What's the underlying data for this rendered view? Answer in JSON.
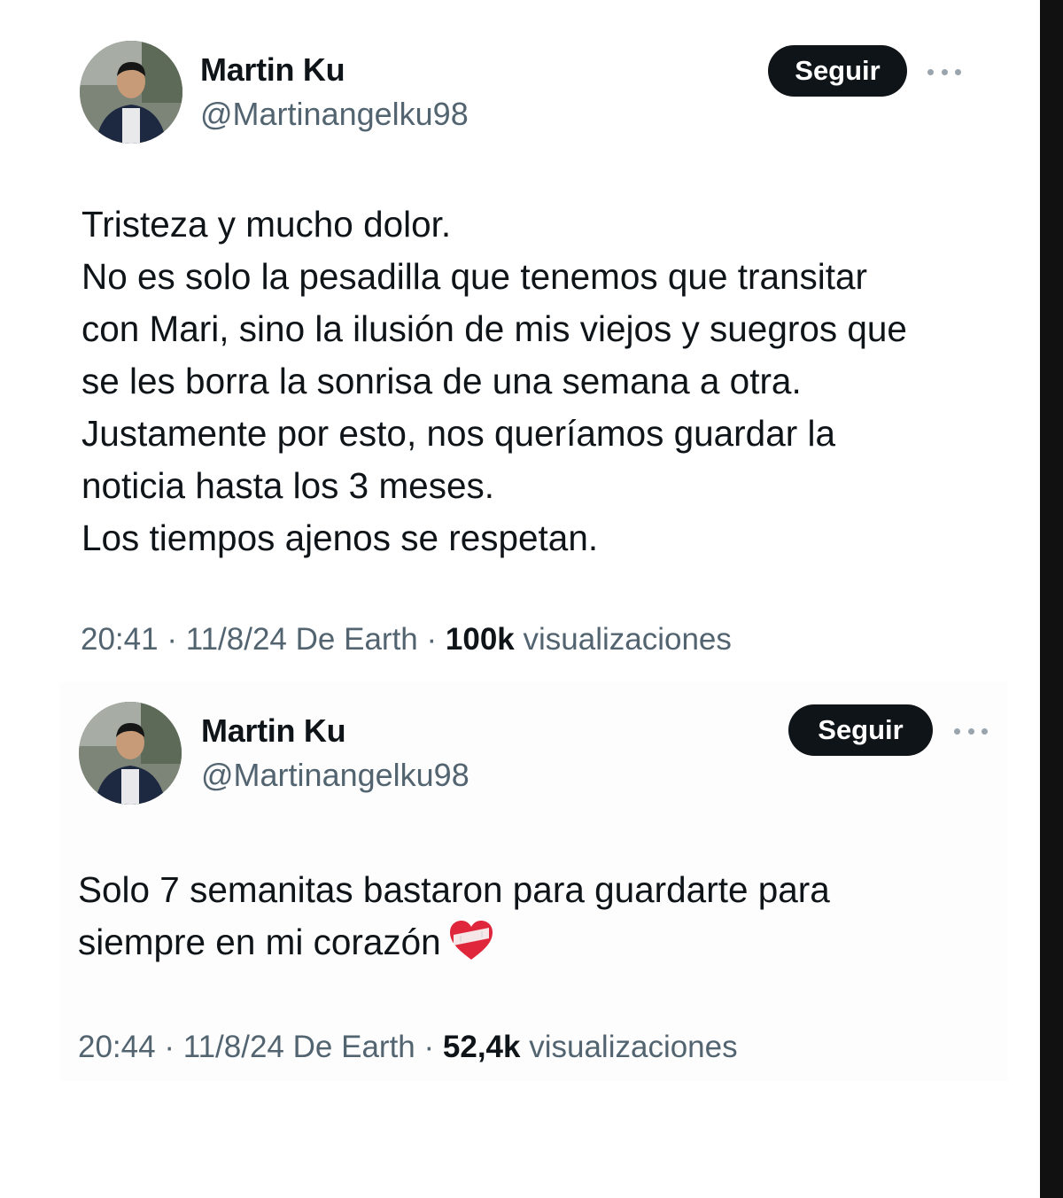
{
  "tweets": [
    {
      "author": {
        "name": "Martin Ku",
        "handle": "@Martinangelku98"
      },
      "follow_label": "Seguir",
      "text_lines": [
        "Tristeza y mucho dolor.",
        "No es solo la pesadilla que tenemos que transitar",
        "con Mari, sino la ilusión de mis viejos y suegros que",
        "se les borra la sonrisa de una semana a otra.",
        "Justamente por esto, nos queríamos guardar la",
        "noticia hasta los 3 meses.",
        "Los tiempos ajenos se respetan."
      ],
      "meta": {
        "time": "20:41",
        "date": "11/8/24",
        "source": "De Earth",
        "views_count": "100k",
        "views_label": "visualizaciones"
      }
    },
    {
      "author": {
        "name": "Martin Ku",
        "handle": "@Martinangelku98"
      },
      "follow_label": "Seguir",
      "text_lines": [
        "Solo 7 semanitas bastaron para guardarte para",
        "siempre en mi corazón"
      ],
      "emoji_icon": "mending-heart-icon",
      "meta": {
        "time": "20:44",
        "date": "11/8/24",
        "source": "De Earth",
        "views_count": "52,4k",
        "views_label": "visualizaciones"
      }
    }
  ],
  "colors": {
    "text": "#0f1419",
    "secondary": "#536471",
    "button_bg": "#0f1419",
    "button_text": "#ffffff",
    "right_bar": "#111111",
    "heart": "#e0263b"
  }
}
